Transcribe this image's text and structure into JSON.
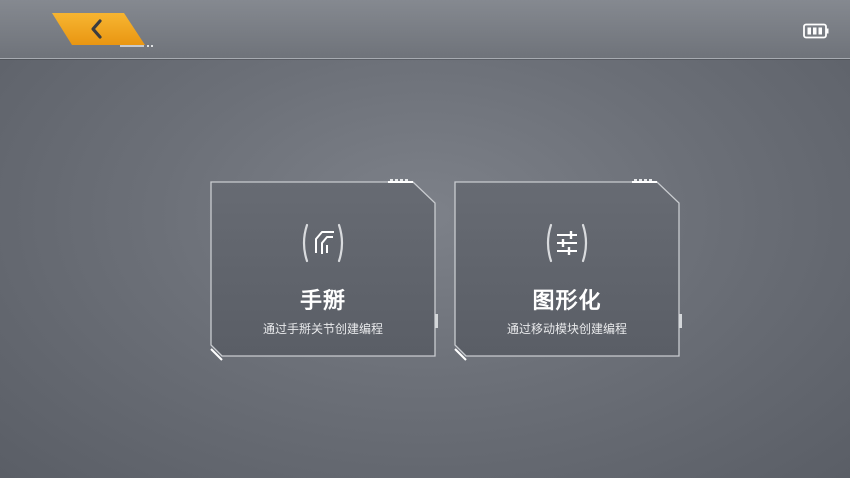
{
  "header": {
    "back_icon": "chevron-left-icon",
    "accent_color": "#f2a51f",
    "battery_icon": "battery-icon"
  },
  "cards": [
    {
      "title": "手掰",
      "subtitle": "通过手掰关节创建编程",
      "icon": "joint-bracket-icon"
    },
    {
      "title": "图形化",
      "subtitle": "通过移动模块创建编程",
      "icon": "sliders-bracket-icon"
    }
  ]
}
